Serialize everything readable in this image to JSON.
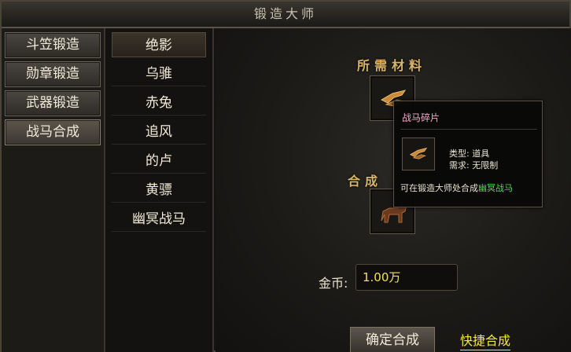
{
  "window": {
    "title": "锻造大师"
  },
  "categories": [
    {
      "label": "斗笠锻造",
      "active": false
    },
    {
      "label": "勋章锻造",
      "active": false
    },
    {
      "label": "武器锻造",
      "active": false
    },
    {
      "label": "战马合成",
      "active": true
    }
  ],
  "horses": [
    {
      "label": "绝影",
      "active": true
    },
    {
      "label": "乌骓",
      "active": false
    },
    {
      "label": "赤兔",
      "active": false
    },
    {
      "label": "追风",
      "active": false
    },
    {
      "label": "的卢",
      "active": false
    },
    {
      "label": "黄骠",
      "active": false
    },
    {
      "label": "幽冥战马",
      "active": false
    }
  ],
  "forge": {
    "materials_label": "所需材料",
    "result_label": "合成",
    "gold_label": "金币:",
    "gold_value": "1.00万",
    "confirm_button": "确定合成",
    "quick_link": "快捷合成"
  },
  "tooltip": {
    "item_name": "战马碎片",
    "type_label": "类型: 道具",
    "req_label": "需求: 无限制",
    "desc_prefix": "可在锻造大师处合成",
    "desc_highlight": "幽冥战马"
  },
  "colors": {
    "gold_text": "#d9b46a",
    "currency_yellow": "#f2e25a",
    "item_name_pink": "#f4a9c9",
    "highlight_green": "#4fdc4f"
  },
  "icons": {
    "material_slot": "horse-fragment-icon",
    "result_slot": "horse-icon"
  }
}
